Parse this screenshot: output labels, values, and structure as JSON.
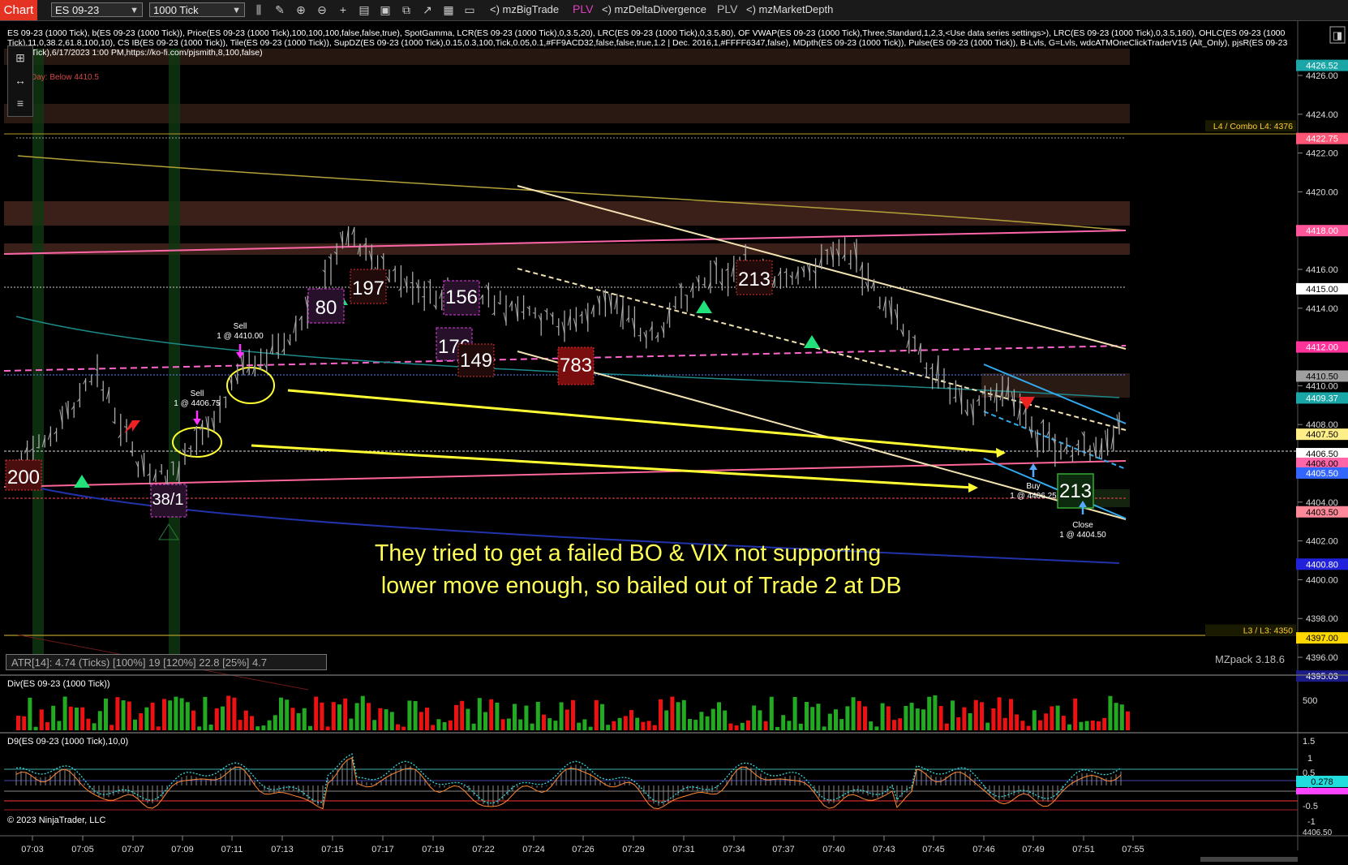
{
  "toolbar": {
    "tab_label": "Chart",
    "instrument": "ES 09-23",
    "interval": "1000 Tick",
    "indicators": [
      {
        "prefix": "<)",
        "name": "mzBigTrade"
      },
      {
        "prefix": "",
        "name": "PLV"
      },
      {
        "prefix": "<)",
        "name": "mzDeltaDivergence"
      },
      {
        "prefix": "",
        "name": "PLV"
      },
      {
        "prefix": "<)",
        "name": "mzMarketDepth"
      }
    ]
  },
  "chart_header": "ES 09-23 (1000 Tick), b(ES 09-23 (1000 Tick)), Price(ES 09-23 (1000 Tick),100,100,100,false,false,true), SpotGamma, LCR(ES 09-23 (1000 Tick),0,3.5,20), LRC(ES 09-23 (1000 Tick),0,3.5,80), OF VWAP(ES 09-23 (1000 Tick),Three,Standard,1,2,3,<Use data series settings>), LRC(ES 09-23 (1000 Tick),0,3.5,160), OHLC(ES 09-23 (1000 Tick),11,0,38.2,61.8,100,10), CS IB(ES 09-23 (1000 Tick)), Tile(ES 09-23 (1000 Tick)), SupDZ(ES 09-23 (1000 Tick),0.15,0.3,100,Tick,0.05,0.1,#FF9ACD32,false,false,true,1.2 | Dec. 2016,1,#FFFF6347,false), MDpth(ES 09-23 (1000 Tick)), Pulse(ES 09-23 (1000 Tick)), B-Lvls, G=Lvls, wdcATMOneClickTraderV15 (Alt_Only), pjsR(ES 09-23 (1000 Tick),6/17/2023 1:00 PM,https://ko-fi.com/pjsmith,8,100,false)",
  "day_label": "Day: Below 4410.5",
  "price_axis": {
    "ticks": [
      "4426.00",
      "4424.00",
      "4422.00",
      "4420.00",
      "4418.00",
      "4416.00",
      "4414.00",
      "4412.00",
      "4410.00",
      "4408.00",
      "4406.00",
      "4404.00",
      "4402.00",
      "4400.00",
      "4398.00",
      "4396.00"
    ],
    "tick_values": [
      4426,
      4424,
      4422,
      4420,
      4418,
      4416,
      4414,
      4412,
      4410,
      4408,
      4406,
      4404,
      4402,
      4400,
      4398,
      4396
    ],
    "badges": [
      {
        "text": "4426.52",
        "value": 4426.52,
        "color": "#1aa6a6"
      },
      {
        "text": "4422.75",
        "value": 4422.75,
        "color": "#ff5577"
      },
      {
        "text": "4418.00",
        "value": 4418.0,
        "color": "#ff5599"
      },
      {
        "text": "4415.00",
        "value": 4415.0,
        "color": "#ffffff"
      },
      {
        "text": "4412.00",
        "value": 4412.0,
        "color": "#ff3399"
      },
      {
        "text": "4410.50",
        "value": 4410.5,
        "color": "#a0a0a0"
      },
      {
        "text": "4409.37",
        "value": 4409.37,
        "color": "#1aa6a6"
      },
      {
        "text": "4407.50",
        "value": 4407.5,
        "color": "#ffee88"
      },
      {
        "text": "4406.50",
        "value": 4406.5,
        "color": "#ffffff"
      },
      {
        "text": "4406.00",
        "value": 4406.0,
        "color": "#ff66aa"
      },
      {
        "text": "4405.50",
        "value": 4405.5,
        "color": "#3366ff"
      },
      {
        "text": "4403.50",
        "value": 4403.5,
        "color": "#ff8899"
      },
      {
        "text": "4400.80",
        "value": 4400.8,
        "color": "#2222dd"
      },
      {
        "text": "4397.00",
        "value": 4397.0,
        "color": "#ffd700"
      },
      {
        "text": "4395.03",
        "value": 4395.03,
        "color": "#1c1c88"
      }
    ],
    "level_labels": [
      {
        "text": "L4 / Combo L4: 4376",
        "value": 4423.4
      },
      {
        "text": "L3 / L3: 4350",
        "value": 4397.4
      }
    ]
  },
  "time_axis": [
    "07:03",
    "07:05",
    "07:07",
    "07:09",
    "07:11",
    "07:13",
    "07:15",
    "07:17",
    "07:19",
    "07:22",
    "07:24",
    "07:26",
    "07:29",
    "07:31",
    "07:34",
    "07:37",
    "07:40",
    "07:43",
    "07:45",
    "07:46",
    "07:49",
    "07:51",
    "07:55"
  ],
  "trades": [
    {
      "action": "Sell",
      "detail": "1 @ 4410.00"
    },
    {
      "action": "Sell",
      "detail": "1 @ 4406.75"
    },
    {
      "action": "Buy",
      "detail": "1 @ 4406.25"
    },
    {
      "action": "Close",
      "detail": "1 @ 4404.50"
    }
  ],
  "volume_boxes": [
    "200",
    "38/1",
    "80",
    "197",
    "156",
    "176",
    "149",
    "783",
    "213",
    "213"
  ],
  "annotation": "They tried to get a failed BO & VIX not supporting\n lower move enough, so bailed out of Trade 2 at DB",
  "atr_text": "ATR[14]: 4.74 (Ticks) [100%] 19  [120%] 22.8  [25%] 4.7",
  "mzpack": "MZpack 3.18.6",
  "div_panel": {
    "title": "Div(ES 09-23 (1000 Tick))",
    "axis": [
      "500"
    ]
  },
  "d9_panel": {
    "title": "D9(ES 09-23 (1000 Tick),10,0)",
    "axis": [
      "1.5",
      "1",
      "0.5",
      "0",
      "-0.5",
      "-1"
    ],
    "badge": "0.278",
    "bottom_label": "4406.50"
  },
  "copyright": "© 2023 NinjaTrader, LLC"
}
